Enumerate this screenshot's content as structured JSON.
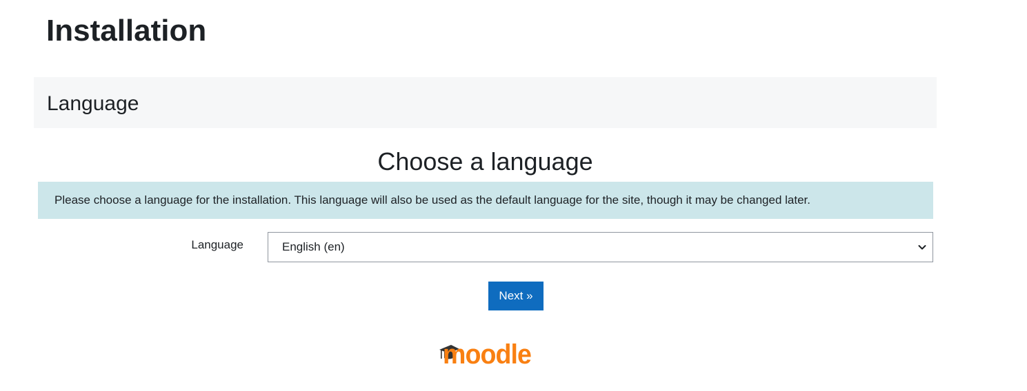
{
  "page": {
    "title": "Installation"
  },
  "section": {
    "title": "Language"
  },
  "stage": {
    "heading": "Choose a language",
    "info": "Please choose a language for the installation. This language will also be used as the default language for the site, though it may be changed later."
  },
  "form": {
    "language_label": "Language",
    "language_selected": "English (en)",
    "next_label": "Next »"
  },
  "logo": {
    "text": "moodle",
    "color": "#f98012",
    "cap_color": "#333333"
  },
  "colors": {
    "primary": "#0f6cbf",
    "info_bg": "#cce6ea",
    "header_bg": "#f6f7f8",
    "text": "#1d2125"
  },
  "icons": {
    "select_caret": "chevron-down-icon",
    "logo_cap": "graduation-cap-icon"
  }
}
